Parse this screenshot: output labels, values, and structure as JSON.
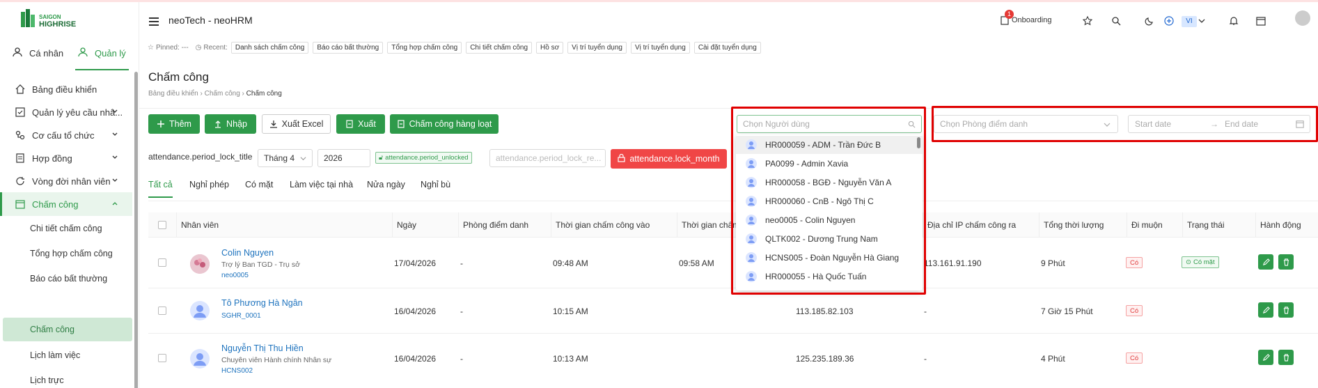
{
  "app": {
    "title": "neoTech - neoHRM",
    "logo_top": "SAIGON",
    "logo_bottom": "HIGHRISE",
    "brand_color": "#2e9a4a"
  },
  "roles": {
    "personal": "Cá nhân",
    "manage": "Quản lý"
  },
  "sidebar": {
    "items": [
      {
        "label": "Bảng điều khiển",
        "icon": "home-icon"
      },
      {
        "label": "Quản lý yêu cầu nhâ...",
        "icon": "checkbox-icon"
      },
      {
        "label": "Cơ cấu tổ chức",
        "icon": "org-icon"
      },
      {
        "label": "Hợp đồng",
        "icon": "document-icon"
      },
      {
        "label": "Vòng đời nhân viên",
        "icon": "cycle-icon"
      },
      {
        "label": "Chấm công",
        "icon": "calendar-icon"
      }
    ],
    "sub_items": [
      "Chi tiết chấm công",
      "Tổng hợp chấm công",
      "Báo cáo bất thường",
      "Chấm công",
      "Lịch làm việc",
      "Lịch trực"
    ]
  },
  "header": {
    "onboarding_label": "Onboarding",
    "onboarding_count": "1",
    "lang": "VI"
  },
  "pinned": {
    "pinned_label": "Pinned: ---",
    "recent_label": "Recent:",
    "recent": [
      "Danh sách chấm công",
      "Báo cáo bất thường",
      "Tổng hợp chấm công",
      "Chi tiết chấm công",
      "Hồ sơ",
      "Vị trí tuyển dụng",
      "Vị trí tuyển dụng",
      "Cài đặt tuyển dụng"
    ]
  },
  "page": {
    "title": "Chấm công",
    "breadcrumb": [
      "Bảng điều khiển",
      "Chấm công",
      "Chấm công"
    ]
  },
  "actions": {
    "add": "Thêm",
    "import": "Nhập",
    "export_excel": "Xuất Excel",
    "export": "Xuất",
    "bulk": "Chấm công hàng loạt"
  },
  "filters": {
    "user_placeholder": "Chọn Người dùng",
    "room_placeholder": "Chọn Phòng điểm danh",
    "start_date": "Start date",
    "end_date": "End date"
  },
  "lock": {
    "title": "attendance.period_lock_title",
    "month": "Tháng 4",
    "year": "2026",
    "status": "attendance.period_unlocked",
    "reason_placeholder": "attendance.period_lock_re...",
    "lock_button": "attendance.lock_month"
  },
  "tabs": [
    "Tất cả",
    "Nghỉ phép",
    "Có mặt",
    "Làm việc tại nhà",
    "Nửa ngày",
    "Nghỉ bù"
  ],
  "table": {
    "headers": [
      "Nhân viên",
      "Ngày",
      "Phòng điểm danh",
      "Thời gian chấm công vào",
      "Thời gian chấm",
      "Địa chỉ IP chấm công ra",
      "Tổng thời lượng",
      "Đi muộn",
      "Trạng thái",
      "Hành động"
    ],
    "rows": [
      {
        "name": "Colin Nguyen",
        "position": "Trợ lý Ban TGD - Trụ sở",
        "code": "neo0005",
        "date": "17/04/2026",
        "room": "-",
        "in": "09:48 AM",
        "out": "09:58 AM",
        "ip_in": "",
        "ip_out": "113.161.91.190",
        "duration": "9 Phút",
        "late": "Có",
        "status": "Có mặt"
      },
      {
        "name": "Tô Phương Hà Ngân",
        "position": "",
        "code": "SGHR_0001",
        "date": "16/04/2026",
        "room": "-",
        "in": "10:15 AM",
        "out": "",
        "ip_in": "113.185.82.103",
        "ip_out": "-",
        "duration": "7 Giờ 15 Phút",
        "late": "Có",
        "status": ""
      },
      {
        "name": "Nguyễn Thị Thu Hiền",
        "position": "Chuyên viên Hành chính Nhân sự",
        "code": "HCNS002",
        "date": "16/04/2026",
        "room": "-",
        "in": "10:13 AM",
        "out": "",
        "ip_in": "125.235.189.36",
        "ip_out": "-",
        "duration": "4 Phút",
        "late": "Có",
        "status": ""
      }
    ]
  },
  "user_dropdown": [
    "HR000059 - ADM - Trần Đức B",
    "PA0099 - Admin Xavia",
    "HR000058 - BGĐ - Nguyễn Văn A",
    "HR000060 - CnB - Ngô Thị C",
    "neo0005 - Colin Nguyen",
    "QLTK002 - Dương Trung Nam",
    "HCNS005 - Đoàn Nguyễn Hà Giang",
    "HR000055 - Hà Quốc Tuấn"
  ]
}
